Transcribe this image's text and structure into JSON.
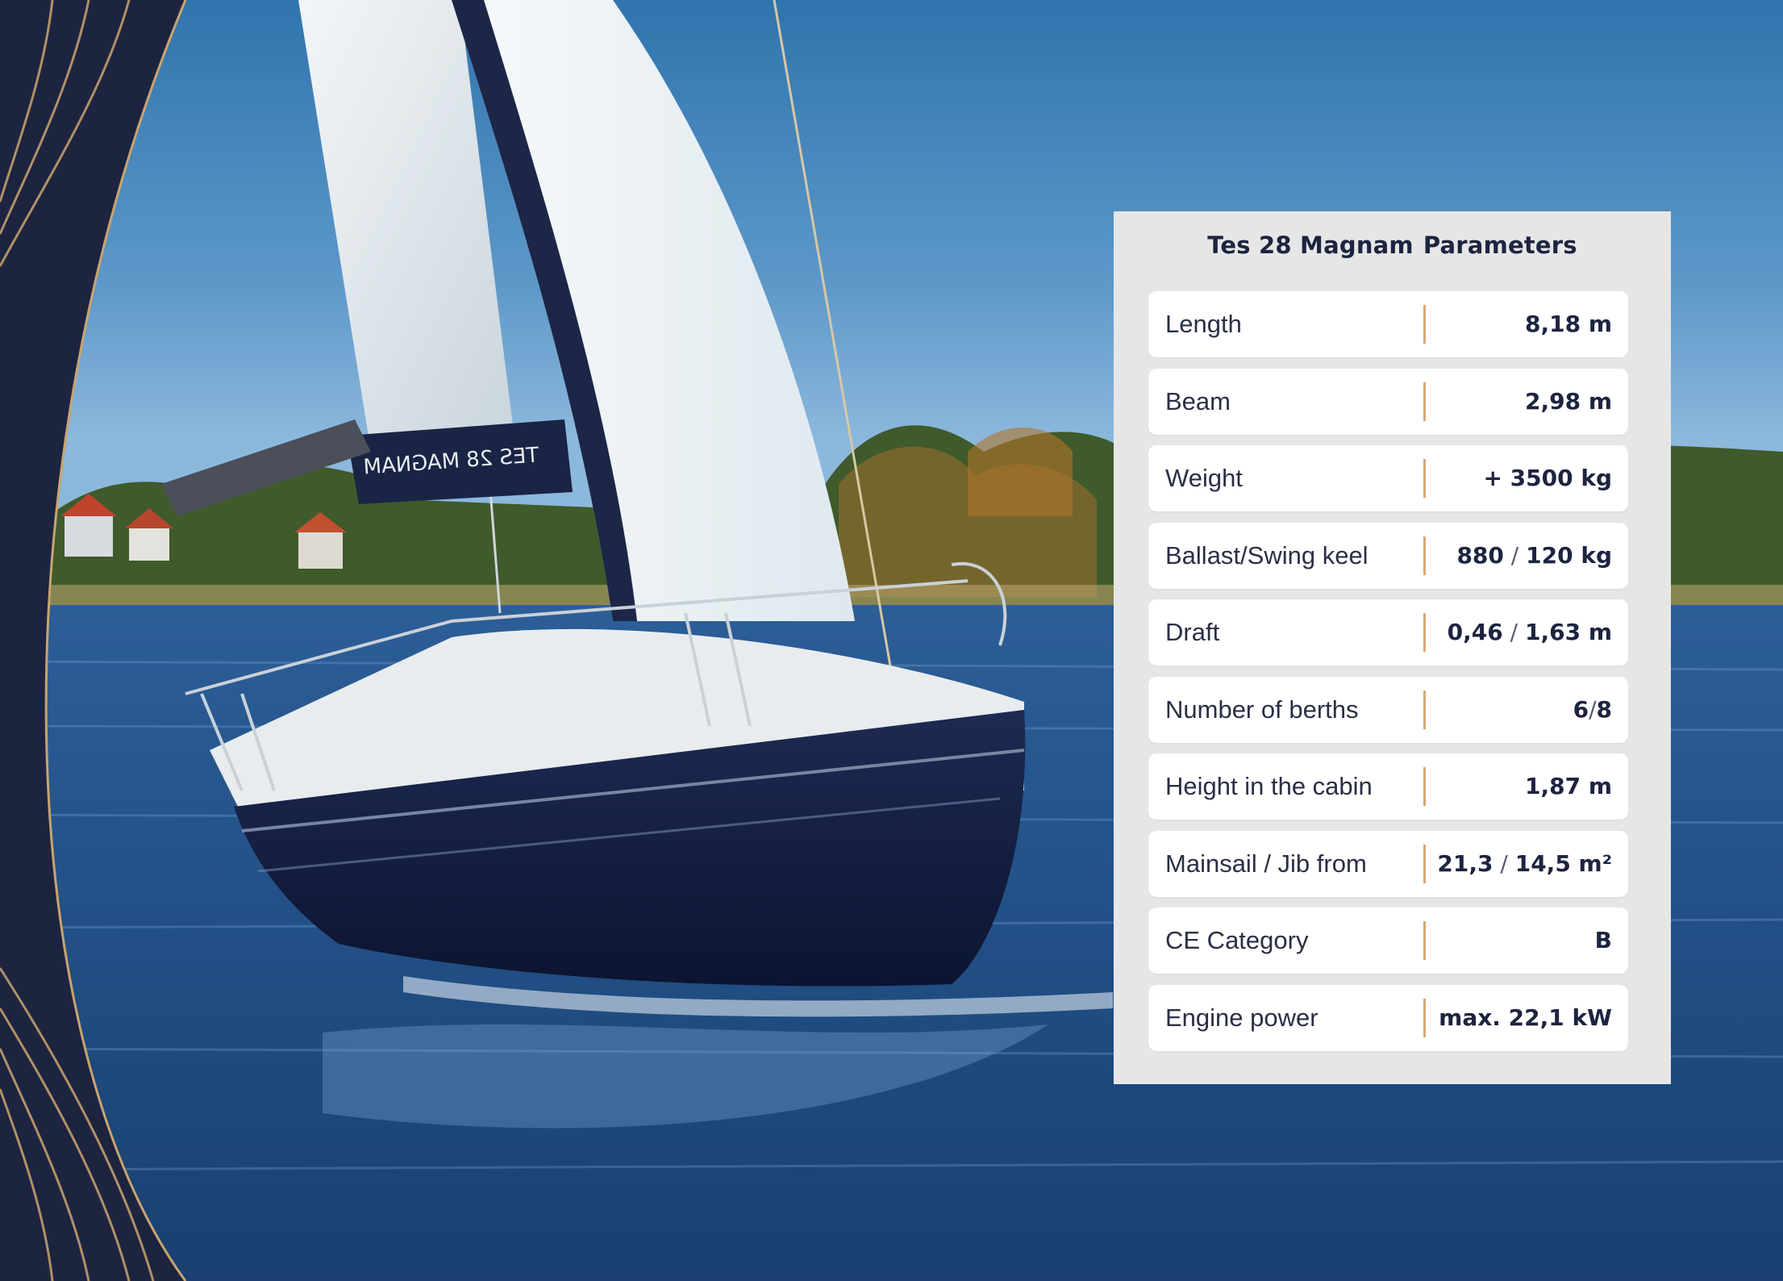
{
  "panel": {
    "title_part1": "Tes 28 Magnam",
    "title_part2": "Parameters",
    "separator_color": "#d9a878",
    "background_color": "#e6e6e6"
  },
  "parameters": [
    {
      "label": "Length",
      "value": "8,18 m"
    },
    {
      "label": "Beam",
      "value": "2,98 m"
    },
    {
      "label": "Weight",
      "value": "+ 3500 kg"
    },
    {
      "label": "Ballast/Swing keel",
      "value_a": "880",
      "value_b": "120 kg"
    },
    {
      "label": "Draft",
      "value_a": "0,46",
      "value_b": "1,63 m"
    },
    {
      "label": "Number of berths",
      "value_a": "6",
      "value_b": "8"
    },
    {
      "label": "Height in the cabin",
      "value": "1,87 m"
    },
    {
      "label": "Mainsail / Jib from",
      "value_a": "21,3",
      "value_b": "14,5 m²"
    },
    {
      "label": "CE Category",
      "value": "B"
    },
    {
      "label": "Engine power",
      "value": "max. 22,1 kW"
    }
  ],
  "photo": {
    "boat_name_text": "TES 28 MAGNAM"
  },
  "colors": {
    "navy": "#1d2440",
    "gold": "#c9a46e",
    "sky": "#6ea3cf",
    "water": "#24548c"
  }
}
